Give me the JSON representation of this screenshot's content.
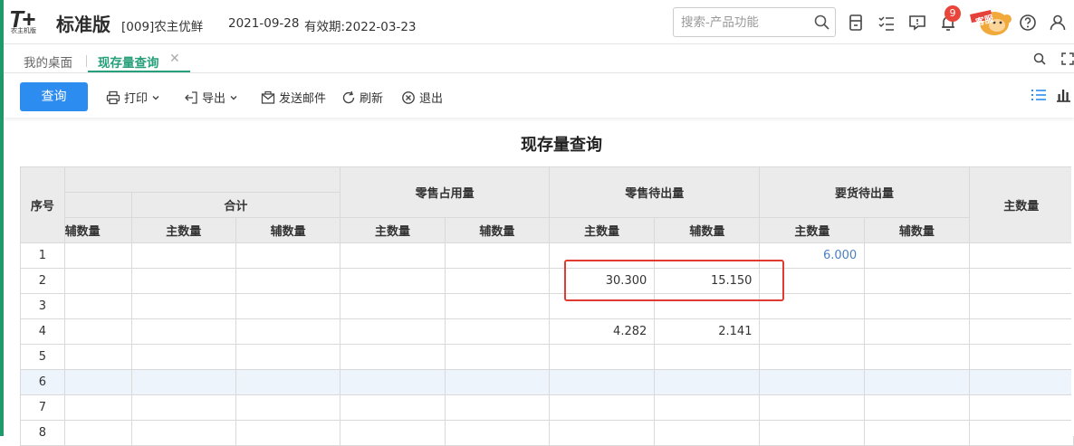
{
  "header": {
    "logo_mark": "T+",
    "logo_sub": "农主机版",
    "edition": "标准版",
    "company": "[009]农主优鲜",
    "date": "2021-09-28",
    "validity": "有效期:2022-03-23",
    "search_placeholder": "搜索-产品功能",
    "notification_count": "9",
    "service_label": "客服"
  },
  "tabs": [
    {
      "label": "我的桌面",
      "active": false
    },
    {
      "label": "现存量查询",
      "active": true
    }
  ],
  "toolbar": {
    "query": "查询",
    "print": "打印",
    "export": "导出",
    "send_mail": "发送邮件",
    "refresh": "刷新",
    "exit": "退出"
  },
  "report": {
    "title": "现存量查询",
    "headers": {
      "seq": "序号",
      "total": "合计",
      "retail_occupied": "零售占用量",
      "retail_pending_out": "零售待出量",
      "request_pending_out": "要货待出量",
      "main_qty": "主数量",
      "aux_qty": "辅数量",
      "aux_qty_clipped": "辅数量"
    },
    "rows": [
      {
        "seq": "1",
        "c1": "",
        "c2": "",
        "c3": "",
        "c4": "",
        "c5": "",
        "c6": "",
        "c7": "",
        "c8": "6.000",
        "c9": "",
        "c10": ""
      },
      {
        "seq": "2",
        "c1": "",
        "c2": "",
        "c3": "",
        "c4": "",
        "c5": "",
        "c6": "30.300",
        "c7": "15.150",
        "c8": "",
        "c9": "",
        "c10": ""
      },
      {
        "seq": "3",
        "c1": "",
        "c2": "",
        "c3": "",
        "c4": "",
        "c5": "",
        "c6": "",
        "c7": "",
        "c8": "",
        "c9": "",
        "c10": ""
      },
      {
        "seq": "4",
        "c1": "",
        "c2": "",
        "c3": "",
        "c4": "",
        "c5": "",
        "c6": "4.282",
        "c7": "2.141",
        "c8": "",
        "c9": "",
        "c10": ""
      },
      {
        "seq": "5",
        "c1": "",
        "c2": "",
        "c3": "",
        "c4": "",
        "c5": "",
        "c6": "",
        "c7": "",
        "c8": "",
        "c9": "",
        "c10": ""
      },
      {
        "seq": "6",
        "c1": "",
        "c2": "",
        "c3": "",
        "c4": "",
        "c5": "",
        "c6": "",
        "c7": "",
        "c8": "",
        "c9": "",
        "c10": ""
      },
      {
        "seq": "7",
        "c1": "",
        "c2": "",
        "c3": "",
        "c4": "",
        "c5": "",
        "c6": "",
        "c7": "",
        "c8": "",
        "c9": "",
        "c10": ""
      },
      {
        "seq": "8",
        "c1": "",
        "c2": "",
        "c3": "",
        "c4": "",
        "c5": "",
        "c6": "",
        "c7": "",
        "c8": "",
        "c9": "",
        "c10": ""
      }
    ]
  },
  "colors": {
    "accent": "#26a07b",
    "primary_button": "#2d8cf0",
    "highlight_box": "#e03b30",
    "selected_row": "#eef4fc",
    "link_value": "#4a7fc1"
  }
}
